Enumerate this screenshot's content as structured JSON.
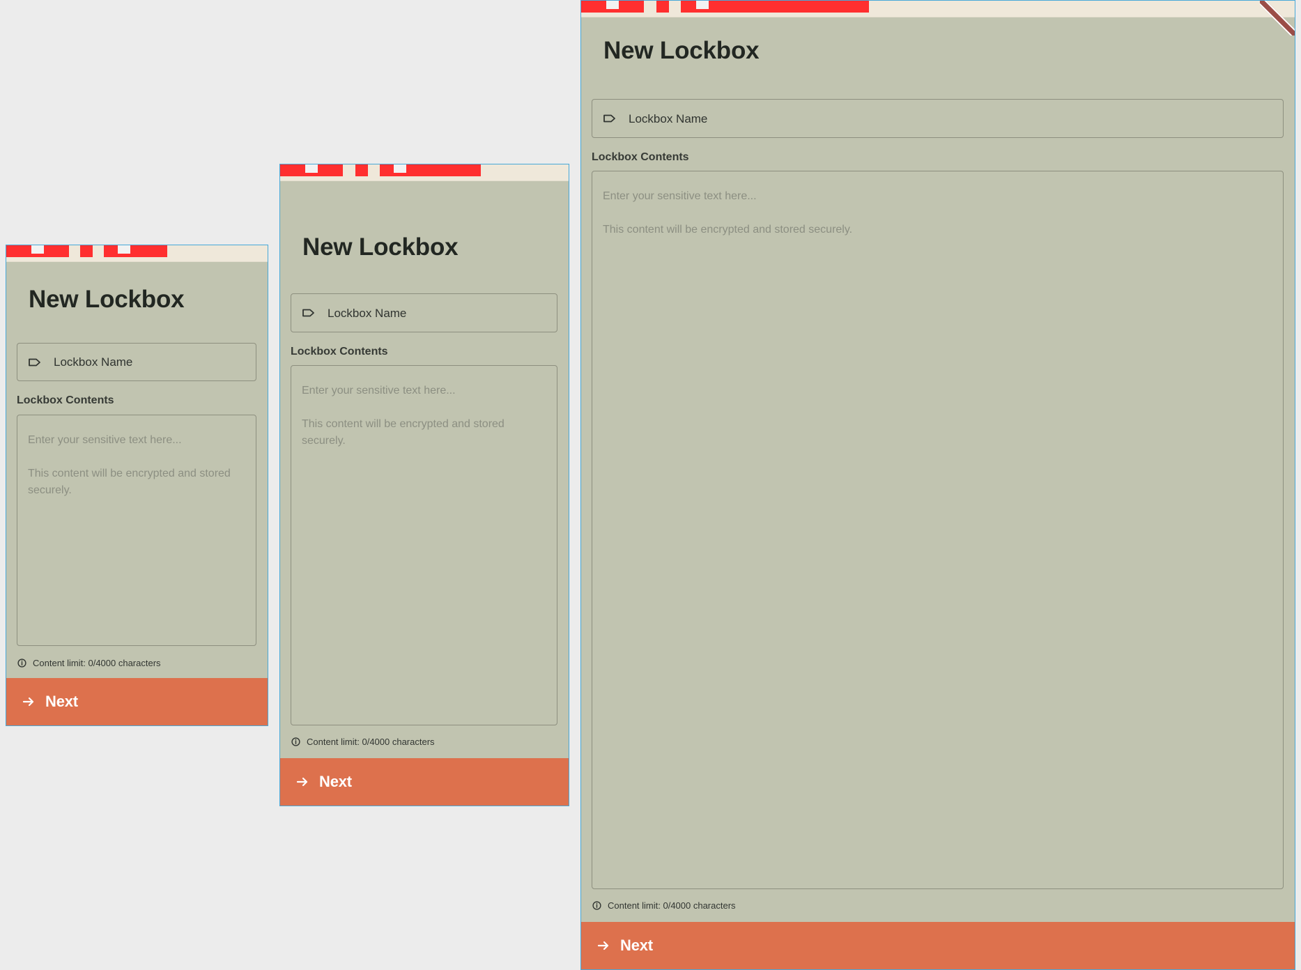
{
  "frames": [
    {
      "title": "New Lockbox",
      "name_field_label": "Lockbox Name",
      "contents_label": "Lockbox Contents",
      "contents_placeholder": "Enter your sensitive text here...\n\nThis content will be encrypted and stored securely.",
      "content_limit": "Content limit: 0/4000 characters",
      "next_label": "Next"
    },
    {
      "title": "New Lockbox",
      "name_field_label": "Lockbox Name",
      "contents_label": "Lockbox Contents",
      "contents_placeholder": "Enter your sensitive text here...\n\nThis content will be encrypted and stored securely.",
      "content_limit": "Content limit: 0/4000 characters",
      "next_label": "Next"
    },
    {
      "title": "New Lockbox",
      "name_field_label": "Lockbox Name",
      "contents_label": "Lockbox Contents",
      "contents_placeholder": "Enter your sensitive text here...\n\nThis content will be encrypted and stored securely.",
      "content_limit": "Content limit: 0/4000 characters",
      "next_label": "Next"
    }
  ],
  "icons": {
    "name_field_icon": "tag-icon",
    "helper_icon": "info-icon",
    "next_icon": "arrow-right-icon"
  },
  "colors": {
    "page_background": "#ececec",
    "panel_background": "#c1c4b0",
    "accent": "#dd714d",
    "frame_outline": "#47a8d8",
    "marker": "#ff2f2f"
  }
}
